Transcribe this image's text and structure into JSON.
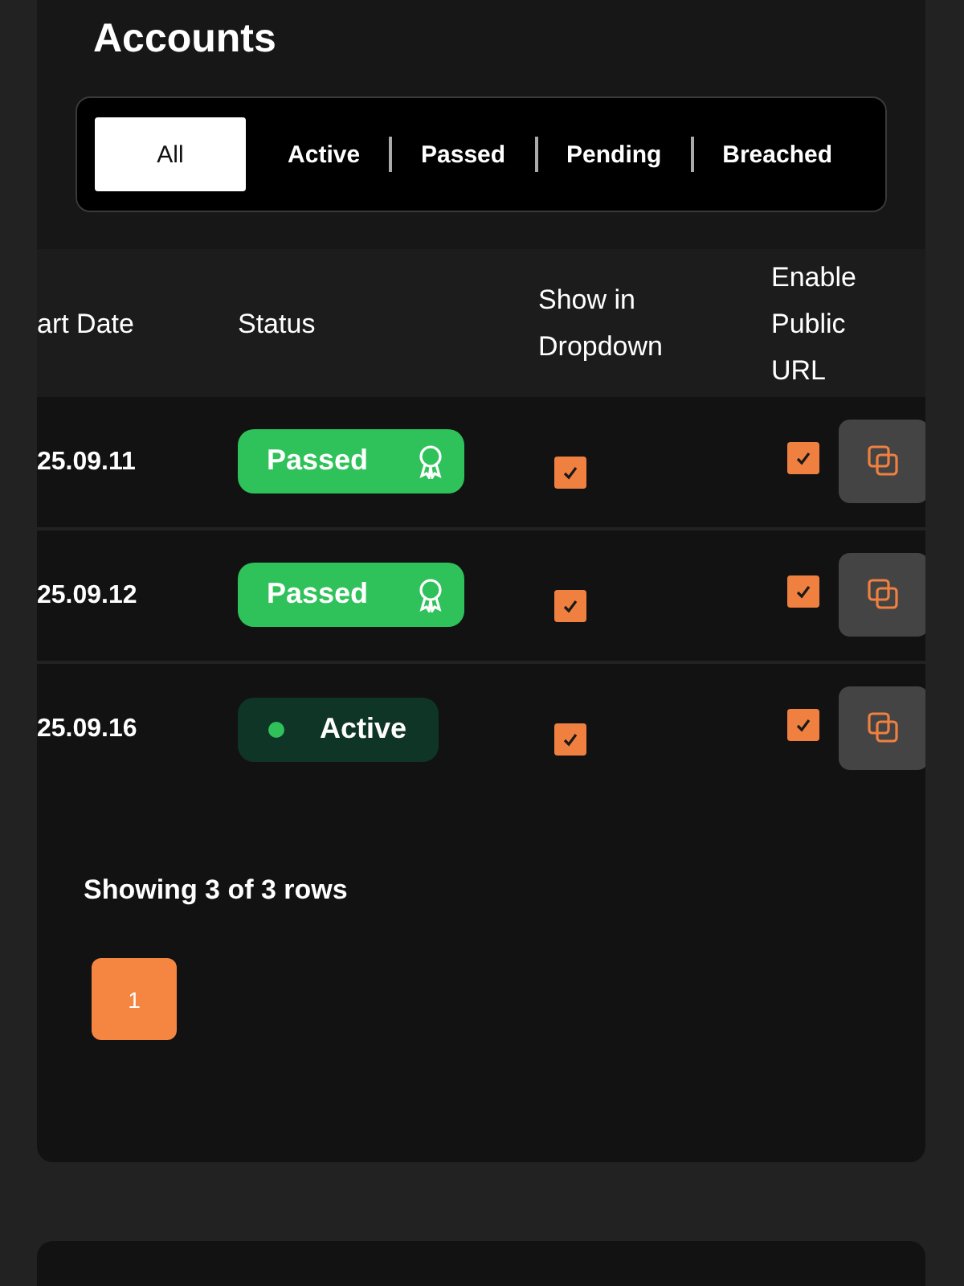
{
  "title": "Accounts",
  "tabs": [
    {
      "label": "All",
      "selected": true
    },
    {
      "label": "Active",
      "selected": false
    },
    {
      "label": "Passed",
      "selected": false
    },
    {
      "label": "Pending",
      "selected": false
    },
    {
      "label": "Breached",
      "selected": false
    }
  ],
  "table": {
    "columns": [
      "art Date",
      "Status",
      "Show in Dropdown",
      "Enable Public URL"
    ],
    "rows": [
      {
        "start_date": "25.09.11",
        "status": {
          "kind": "passed",
          "label": "Passed"
        },
        "show_in_dropdown": true,
        "public_url": true
      },
      {
        "start_date": "25.09.12",
        "status": {
          "kind": "passed",
          "label": "Passed"
        },
        "show_in_dropdown": true,
        "public_url": true
      },
      {
        "start_date": "25.09.16",
        "status": {
          "kind": "active",
          "label": "Active"
        },
        "show_in_dropdown": true,
        "public_url": true
      }
    ]
  },
  "footer": {
    "summary": "Showing 3 of 3 rows",
    "pages": [
      {
        "label": "1",
        "selected": true
      }
    ]
  }
}
